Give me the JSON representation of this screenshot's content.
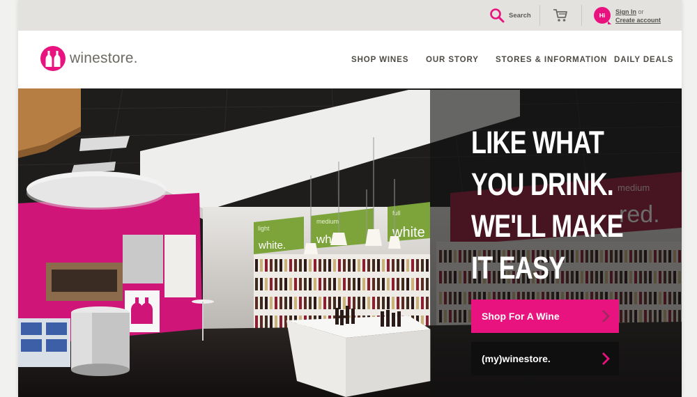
{
  "utility": {
    "search_label": "Search",
    "badge": "Hi",
    "sign_in": "Sign In",
    "or": "or",
    "create_account": "Create account"
  },
  "brand": {
    "name": "winestore."
  },
  "nav": [
    "SHOP WINES",
    "OUR STORY",
    "STORES & INFORMATION",
    "DAILY DEALS"
  ],
  "hero": {
    "headline": [
      "LIKE WHAT",
      "YOU DRINK.",
      "WE'LL MAKE",
      "IT EASY"
    ],
    "store_signs": [
      {
        "tag": "light",
        "word": "white."
      },
      {
        "tag": "medium",
        "word": "white."
      },
      {
        "tag": "full",
        "word": "white"
      },
      {
        "tag": "medium",
        "word": "red."
      }
    ],
    "cta_primary": "Shop For A Wine",
    "cta_secondary": "(my)winestore."
  },
  "colors": {
    "brand_pink": "#e8137f",
    "utility_bg": "#e3e2de",
    "sign_green": "#7ca43a"
  }
}
